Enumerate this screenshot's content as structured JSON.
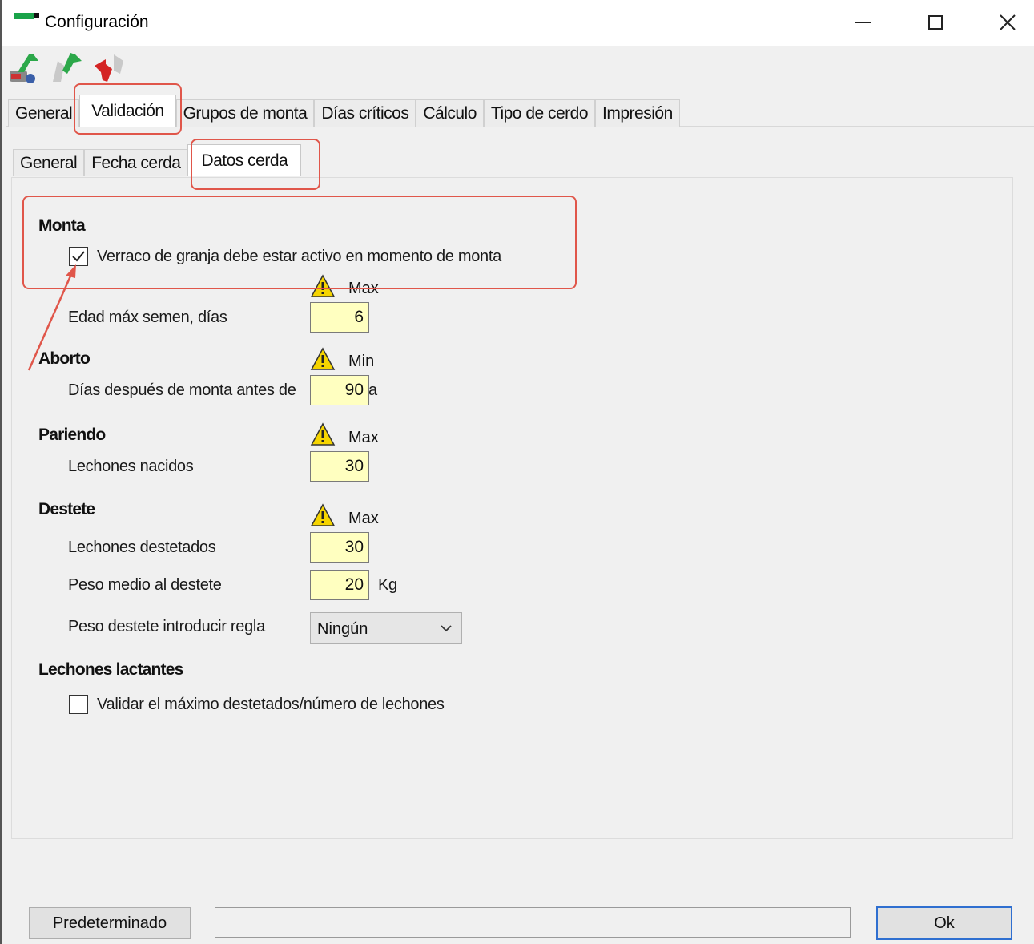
{
  "window": {
    "title": "Configuración",
    "accent": "#1aa34a"
  },
  "toolbar": {
    "icons": [
      "save-all-icon",
      "forward-green-icon",
      "undo-red-icon"
    ]
  },
  "main_tabs": [
    "General",
    "Validación",
    "Grupos de monta",
    "Días críticos",
    "Cálculo",
    "Tipo de cerdo",
    "Impresión"
  ],
  "main_tab_active": "Validación",
  "sub_tabs": [
    "General",
    "Fecha cerda",
    "Datos cerda"
  ],
  "sub_tab_active": "Datos cerda",
  "sections": {
    "monta": {
      "title": "Monta",
      "checkbox_label": "Verraco de granja debe estar activo en momento de monta",
      "checked": true,
      "limit_header": "Max",
      "field_label": "Edad máx semen, días",
      "field_value": "6"
    },
    "aborto": {
      "title": "Aborto",
      "limit_header": "Min",
      "field_label": "Días después de monta antes de",
      "field_value": "90",
      "field_suffix": "a"
    },
    "pariendo": {
      "title": "Pariendo",
      "limit_header": "Max",
      "field_label": "Lechones nacidos",
      "field_value": "30"
    },
    "destete": {
      "title": "Destete",
      "limit_header": "Max",
      "field1_label": "Lechones destetados",
      "field1_value": "30",
      "field2_label": "Peso medio al destete",
      "field2_value": "20",
      "field2_unit": "Kg",
      "select_label": "Peso destete introducir regla",
      "select_value": "Ningún"
    },
    "lactantes": {
      "title": "Lechones lactantes",
      "checkbox_label": "Validar el máximo destetados/número de lechones",
      "checked": false
    }
  },
  "footer": {
    "default_button": "Predeterminado",
    "ok_button": "Ok",
    "status_text": ""
  },
  "colors": {
    "input_bg": "#ffffc0",
    "annotation": "#e0564a",
    "ok_border": "#2f6fd0"
  }
}
